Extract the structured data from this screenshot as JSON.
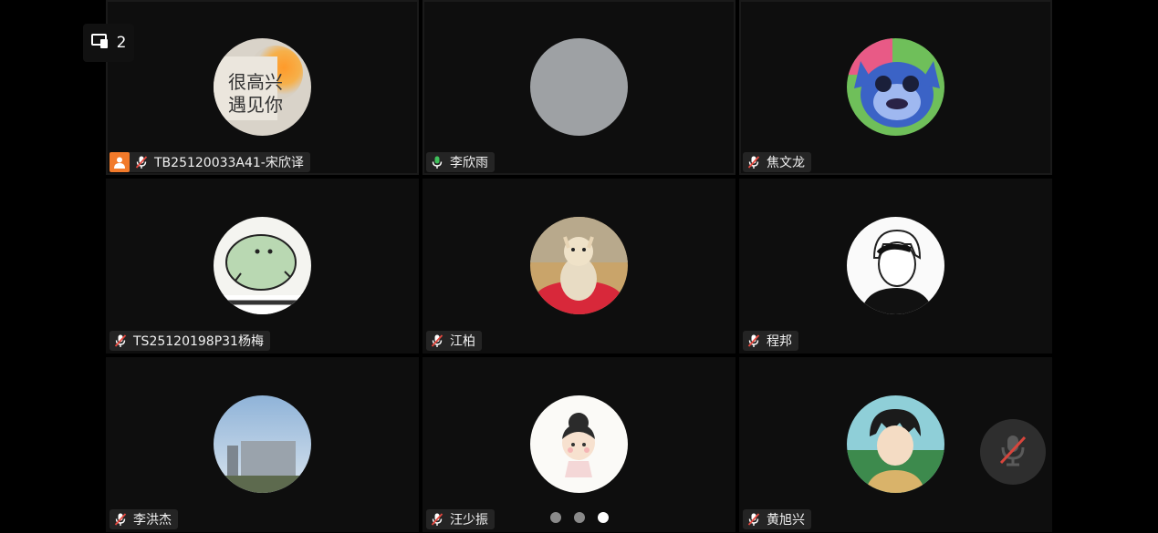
{
  "participant_count": "2",
  "participants": [
    {
      "name": "TB25120033A41-宋欣译",
      "mic": "muted",
      "host": true
    },
    {
      "name": "李欣雨",
      "mic": "on",
      "host": false
    },
    {
      "name": "焦文龙",
      "mic": "muted",
      "host": false
    },
    {
      "name": "TS25120198P31杨梅",
      "mic": "muted",
      "host": false
    },
    {
      "name": "江柏",
      "mic": "muted",
      "host": false
    },
    {
      "name": "程邦",
      "mic": "muted",
      "host": false
    },
    {
      "name": "李洪杰",
      "mic": "muted",
      "host": false
    },
    {
      "name": "汪少振",
      "mic": "muted",
      "host": false
    },
    {
      "name": "黄旭兴",
      "mic": "muted",
      "host": false
    }
  ],
  "pagination": {
    "total_pages": 3,
    "current_page": 3
  },
  "colors": {
    "mic_on": "#3fc15b",
    "mic_off": "#ffffff",
    "mic_slash": "#e5483f",
    "host_badge": "#f27a2a"
  }
}
